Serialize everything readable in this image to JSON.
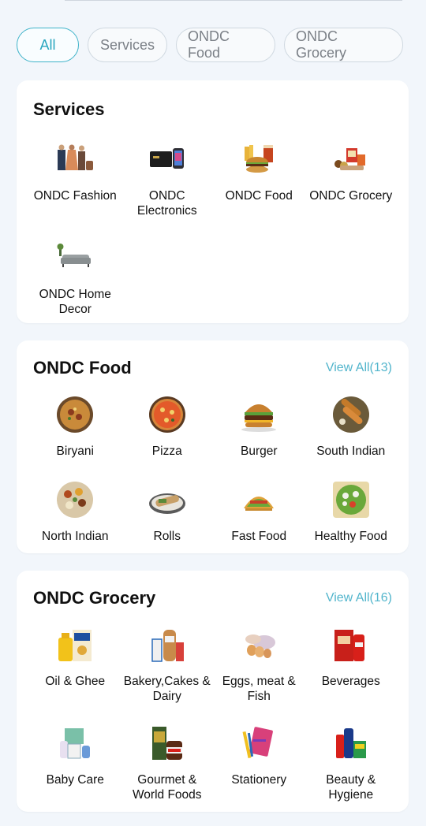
{
  "filters": [
    {
      "label": "All",
      "active": true
    },
    {
      "label": "Services",
      "active": false
    },
    {
      "label": "ONDC Food",
      "active": false
    },
    {
      "label": "ONDC Grocery",
      "active": false
    }
  ],
  "services": {
    "title": "Services",
    "items": [
      {
        "label": "ONDC Fashion",
        "icon": "fashion-icon"
      },
      {
        "label": "ONDC Electronics",
        "icon": "electronics-icon"
      },
      {
        "label": "ONDC Food",
        "icon": "food-icon"
      },
      {
        "label": "ONDC Grocery",
        "icon": "grocery-icon"
      },
      {
        "label": "ONDC Home Decor",
        "icon": "home-decor-icon"
      }
    ]
  },
  "food": {
    "title": "ONDC Food",
    "view_all": "View All(13)",
    "items": [
      {
        "label": "Biryani",
        "icon": "biryani-icon"
      },
      {
        "label": "Pizza",
        "icon": "pizza-icon"
      },
      {
        "label": "Burger",
        "icon": "burger-icon"
      },
      {
        "label": "South Indian",
        "icon": "south-indian-icon"
      },
      {
        "label": "North Indian",
        "icon": "north-indian-icon"
      },
      {
        "label": "Rolls",
        "icon": "rolls-icon"
      },
      {
        "label": "Fast Food",
        "icon": "fast-food-icon"
      },
      {
        "label": "Healthy Food",
        "icon": "healthy-food-icon"
      }
    ]
  },
  "grocery": {
    "title": "ONDC Grocery",
    "view_all": "View All(16)",
    "items": [
      {
        "label": "Oil & Ghee",
        "icon": "oil-ghee-icon"
      },
      {
        "label": "Bakery,Cakes & Dairy",
        "icon": "bakery-icon"
      },
      {
        "label": "Eggs, meat & Fish",
        "icon": "eggs-meat-icon"
      },
      {
        "label": "Beverages",
        "icon": "beverages-icon"
      },
      {
        "label": "Baby Care",
        "icon": "baby-care-icon"
      },
      {
        "label": "Gourmet & World Foods",
        "icon": "gourmet-icon"
      },
      {
        "label": "Stationery",
        "icon": "stationery-icon"
      },
      {
        "label": "Beauty & Hygiene",
        "icon": "beauty-icon"
      }
    ]
  }
}
